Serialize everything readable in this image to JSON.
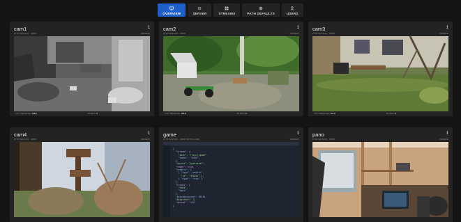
{
  "nav": {
    "overview": "OVERVIEW",
    "server": "SERVER",
    "streams": "STREAMS",
    "path_defaults": "PATH DEFAULTS",
    "users": "USERS"
  },
  "cards": [
    {
      "name": "cam1",
      "sub": "RTSP SESSION · 1080P",
      "count": "1",
      "count_label": "VIEWERS",
      "foot_left_label": "LAST RECEIVED:",
      "foot_left_value": "146.9",
      "foot_right_label": "KB SENT:",
      "foot_right_value": "0"
    },
    {
      "name": "cam2",
      "sub": "RTSP SESSION · 1080P",
      "count": "1",
      "count_label": "VIEWERS",
      "foot_left_label": "LAST RECEIVED:",
      "foot_left_value": "155.9",
      "foot_right_label": "KB SENT:",
      "foot_right_value": "0"
    },
    {
      "name": "cam3",
      "sub": "RTSP SESSION · 1080P",
      "count": "1",
      "count_label": "VIEWERS",
      "foot_left_label": "LAST RECEIVED:",
      "foot_left_value": "154.5",
      "foot_right_label": "KB SENT:",
      "foot_right_value": "0"
    },
    {
      "name": "cam4",
      "sub": "RTSP SESSION · 1080P",
      "count": "1",
      "count_label": "VIEWERS"
    },
    {
      "name": "game",
      "sub": "RTSP SESSION · 1080P 60FPS (H.264)",
      "count": "1",
      "count_label": "VIEWERS"
    },
    {
      "name": "pano",
      "sub": "RTSP SESSION · 1080P",
      "count": "1",
      "count_label": "VIEWERS"
    }
  ],
  "code_lines": [
    "{ ",
    "  \"stream\": {",
    "    \"path\": \"rtsp://game\",",
    "    \"codec\": \"h264\",",
    "  },",
    "",
    "  \"source\": \"publisher\",",
    "  \"ready\": true,",
    "  \"readers\": [",
    "    { \"type\": \"webrtc\",",
    "      \"id\": \"3fa2c1\" },",
    "    { \"type\": \"rtsp\" }",
    "  ],",
    "  \"tracks\": [",
    "    \"H264\",",
    "    \"Opus\"",
    "  ],",
    "  \"bytesReceived\": 18234,",
    "  \"bytesSent\": 0,",
    "  \"uptime\": \"12h\"",
    "}"
  ]
}
